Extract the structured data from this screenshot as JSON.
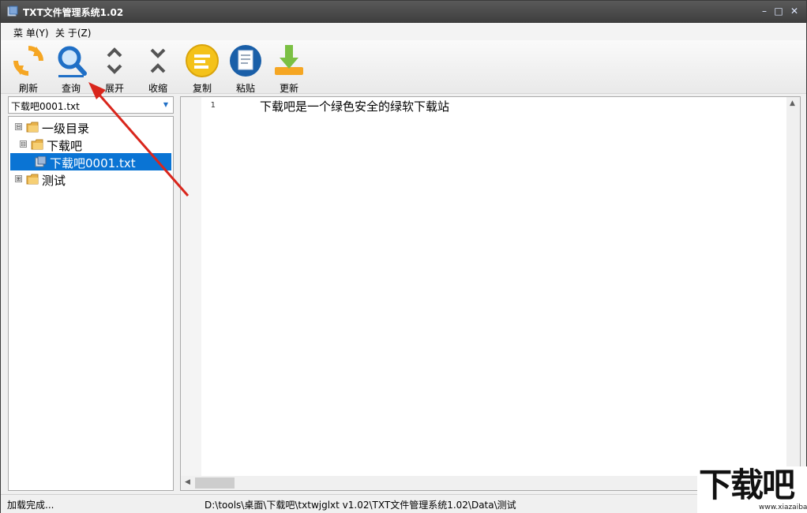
{
  "window": {
    "title": "TXT文件管理系统1.02",
    "controls": [
      "–",
      "□",
      "✕"
    ]
  },
  "menu": {
    "items": [
      "菜 单(Y)",
      "关 于(Z)"
    ]
  },
  "toolbar": {
    "buttons": [
      {
        "label": "刷新",
        "icon": "refresh-icon",
        "color": "#f5a623"
      },
      {
        "label": "查询",
        "icon": "search-icon",
        "color": "#1f6fc6"
      },
      {
        "label": "展开",
        "icon": "expand-icon",
        "color": "#555555"
      },
      {
        "label": "收缩",
        "icon": "collapse-icon",
        "color": "#555555"
      },
      {
        "label": "复制",
        "icon": "copy-icon",
        "color": "#f4c21a"
      },
      {
        "label": "粘贴",
        "icon": "paste-icon",
        "color": "#1a5fa8"
      },
      {
        "label": "更新",
        "icon": "update-icon",
        "color": "#7bc043"
      }
    ]
  },
  "file_combo": {
    "value": "下载吧0001.txt"
  },
  "tree": {
    "nodes": [
      {
        "label": "一级目录",
        "expander": "⊟"
      },
      {
        "label": "下载吧",
        "expander": "⊟"
      },
      {
        "label": "下载吧0001.txt",
        "selected": true
      },
      {
        "label": "测试",
        "expander": "⊞"
      }
    ]
  },
  "editor": {
    "line_number": "1",
    "line_text": "下载吧是一个绿色安全的绿软下载站"
  },
  "status": {
    "message": "加载完成...",
    "path": "D:\\tools\\桌面\\下载吧\\txtwjglxt v1.02\\TXT文件管理系统1.02\\Data\\测试"
  },
  "watermark": {
    "main": "下载吧",
    "sub": "www.xiazaiba.com"
  },
  "colors": {
    "selection": "#0a74d4",
    "annotation_arrow": "#d9261c"
  }
}
